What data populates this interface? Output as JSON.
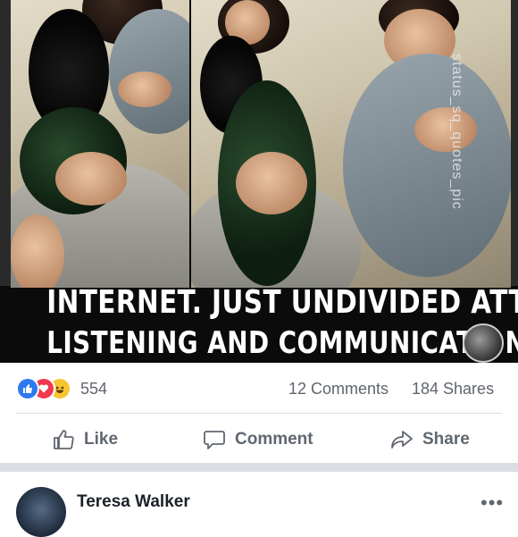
{
  "post": {
    "image_caption_line1": "INTERNET. JUST UNDIVIDED ATTENTION,",
    "image_caption_line2": "LISTENING AND COMMUNICATION",
    "watermark": "status_sq_quotes_pic",
    "reactions_count": "554",
    "reaction_icons": [
      "like-icon",
      "love-icon",
      "haha-icon"
    ],
    "comments_count": "12 Comments",
    "shares_count": "184 Shares"
  },
  "actions": {
    "like_label": "Like",
    "comment_label": "Comment",
    "share_label": "Share"
  },
  "next_post": {
    "author": "Teresa Walker",
    "more_label": "•••"
  },
  "colors": {
    "like_blue": "#2e79f0",
    "love_red": "#f0384e",
    "haha_yellow": "#f7c531",
    "muted_text": "#606770",
    "divider": "#dadde1"
  }
}
